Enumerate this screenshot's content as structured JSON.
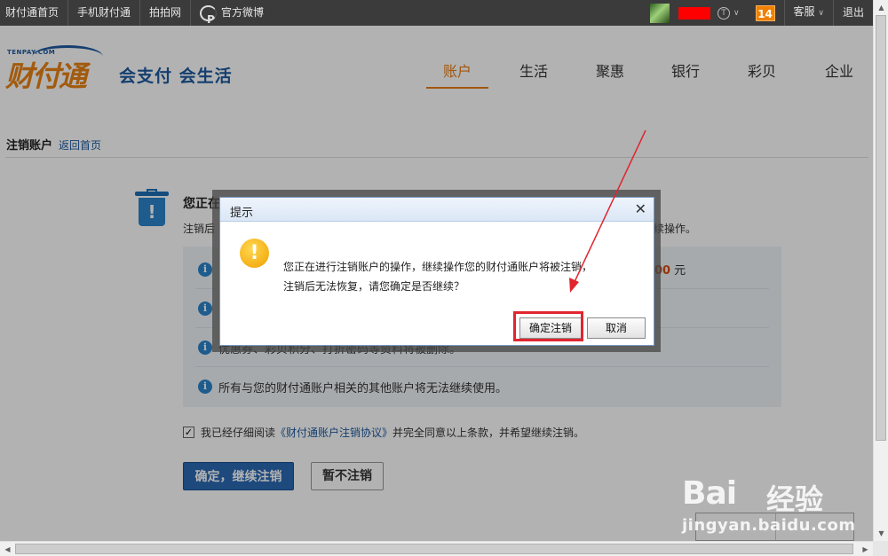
{
  "topbar": {
    "links": [
      "财付通首页",
      "手机财付通",
      "拍拍网",
      "官方微博"
    ],
    "msg_count": "14",
    "service": "客服",
    "logout": "退出"
  },
  "header": {
    "logo_small": "TENPAY.COM",
    "logo_text": "财付通",
    "slogan": "会支付 会生活",
    "nav": [
      "账户",
      "生活",
      "聚惠",
      "银行",
      "彩贝",
      "企业"
    ],
    "active_nav": "账户"
  },
  "page": {
    "title": "注销账户",
    "back_link": "返回首页",
    "warn_title": "您正在",
    "warn_sub_left": "注销后",
    "warn_sub_right": "续操作。",
    "info_items": [
      {
        "text": "",
        "amount": ".00",
        "unit": "元"
      },
      {
        "text": ""
      },
      {
        "text": "优惠券、彩贝积分、打折密码等资料将被删除。"
      },
      {
        "text": "所有与您的财付通账户相关的其他账户将无法继续使用。"
      }
    ],
    "agree_prefix": "我已经仔细阅读",
    "agree_link": "《财付通账户注销协议》",
    "agree_suffix": "并完全同意以上条款，并希望继续注销。",
    "confirm_btn": "确定，继续注销",
    "cancel_btn": "暂不注销"
  },
  "dialog": {
    "title": "提示",
    "close": "✕",
    "message_line1": "您正在进行注销账户的操作，继续操作您的财付通账户将被注销，",
    "message_line2": "注销后无法恢复，请您确定是否继续？",
    "ok": "确定注销",
    "cancel": "取消"
  },
  "watermark": {
    "brand": "Bai",
    "brand_suffix": "经验",
    "url": "jingyan.baidu.com"
  }
}
